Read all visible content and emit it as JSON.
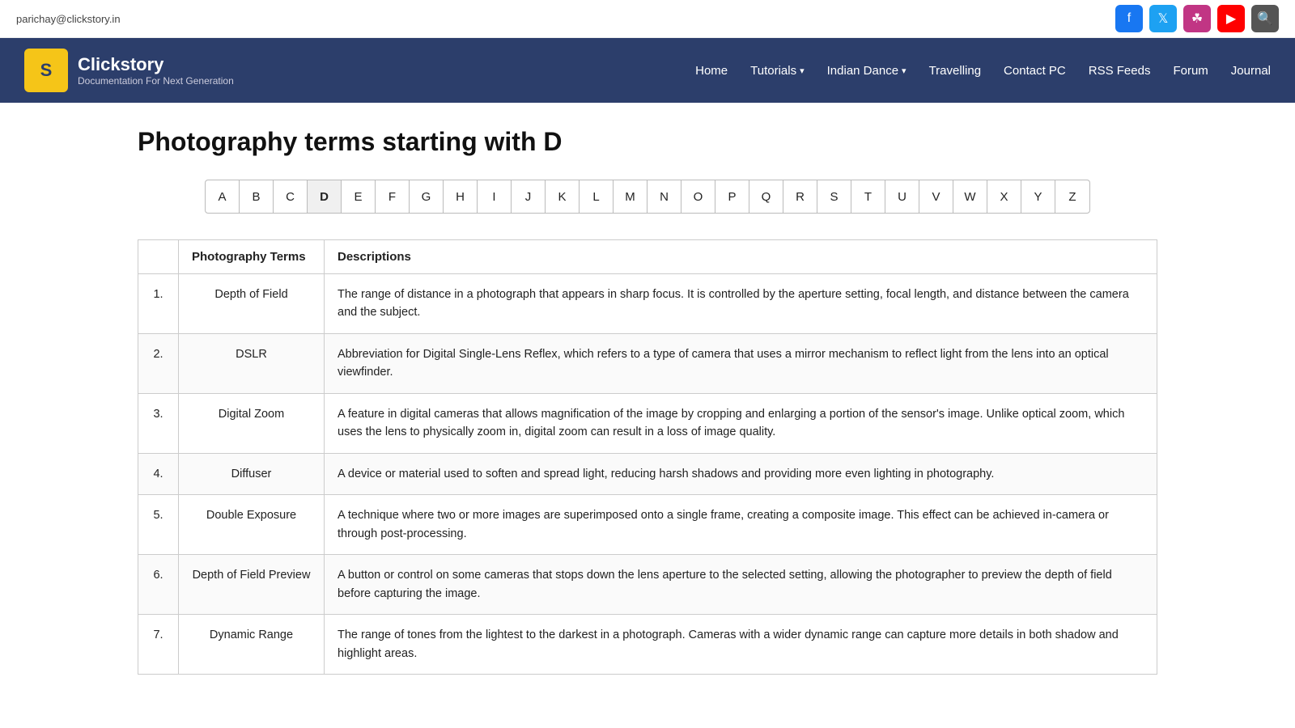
{
  "topbar": {
    "email": "parichay@clickstory.in",
    "social": [
      {
        "name": "facebook",
        "icon": "f",
        "label": "Facebook"
      },
      {
        "name": "twitter",
        "icon": "t",
        "label": "Twitter"
      },
      {
        "name": "instagram",
        "icon": "i",
        "label": "Instagram"
      },
      {
        "name": "youtube",
        "icon": "▶",
        "label": "YouTube"
      },
      {
        "name": "search",
        "icon": "🔍",
        "label": "Search"
      }
    ]
  },
  "nav": {
    "logo_letter": "S",
    "logo_title": "Clickstory",
    "logo_subtitle": "Documentation For Next Generation",
    "links": [
      {
        "label": "Home",
        "dropdown": false
      },
      {
        "label": "Tutorials",
        "dropdown": true
      },
      {
        "label": "Indian Dance",
        "dropdown": true
      },
      {
        "label": "Travelling",
        "dropdown": false
      },
      {
        "label": "Contact PC",
        "dropdown": false
      },
      {
        "label": "RSS Feeds",
        "dropdown": false
      },
      {
        "label": "Forum",
        "dropdown": false
      },
      {
        "label": "Journal",
        "dropdown": false
      }
    ]
  },
  "page": {
    "title": "Photography terms starting with D"
  },
  "alphabet": [
    "A",
    "B",
    "C",
    "D",
    "E",
    "F",
    "G",
    "H",
    "I",
    "J",
    "K",
    "L",
    "M",
    "N",
    "O",
    "P",
    "Q",
    "R",
    "S",
    "T",
    "U",
    "V",
    "W",
    "X",
    "Y",
    "Z"
  ],
  "active_letter": "D",
  "table": {
    "headers": [
      "",
      "Photography Terms",
      "Descriptions"
    ],
    "rows": [
      {
        "num": "1.",
        "term": "Depth of Field",
        "desc": "The range of distance in a photograph that appears in sharp focus. It is controlled by the aperture setting, focal length, and distance between the camera and the subject."
      },
      {
        "num": "2.",
        "term": "DSLR",
        "desc": "Abbreviation for Digital Single-Lens Reflex, which refers to a type of camera that uses a mirror mechanism to reflect light from the lens into an optical viewfinder."
      },
      {
        "num": "3.",
        "term": "Digital Zoom",
        "desc": "A feature in digital cameras that allows magnification of the image by cropping and enlarging a portion of the sensor's image. Unlike optical zoom, which uses the lens to physically zoom in, digital zoom can result in a loss of image quality."
      },
      {
        "num": "4.",
        "term": "Diffuser",
        "desc": "A device or material used to soften and spread light, reducing harsh shadows and providing more even lighting in photography."
      },
      {
        "num": "5.",
        "term": "Double Exposure",
        "desc": "A technique where two or more images are superimposed onto a single frame, creating a composite image. This effect can be achieved in-camera or through post-processing."
      },
      {
        "num": "6.",
        "term": "Depth of Field Preview",
        "desc": "A button or control on some cameras that stops down the lens aperture to the selected setting, allowing the photographer to preview the depth of field before capturing the image."
      },
      {
        "num": "7.",
        "term": "Dynamic Range",
        "desc": "The range of tones from the lightest to the darkest in a photograph. Cameras with a wider dynamic range can capture more details in both shadow and highlight areas."
      }
    ]
  }
}
